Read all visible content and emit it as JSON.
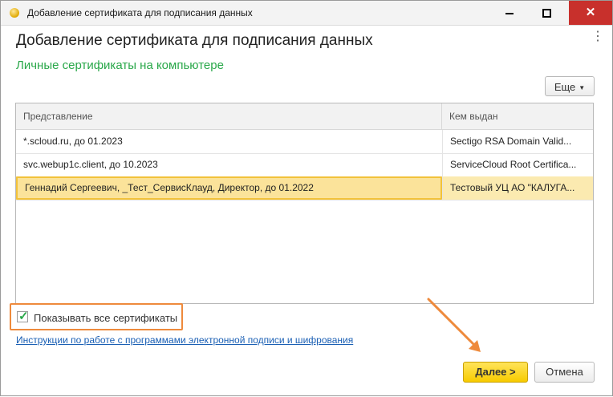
{
  "window": {
    "title": "Добавление сертификата для подписания данных",
    "app_icon": "1c-app-icon",
    "controls": [
      "minimize-icon",
      "maximize-icon",
      "close-icon"
    ]
  },
  "form": {
    "title": "Добавление сертификата для подписания данных",
    "menu_icon": "kebab-menu-icon",
    "section_label": "Личные сертификаты на компьютере",
    "more_button": {
      "label": "Еще",
      "icon": "caret-down-icon"
    }
  },
  "table": {
    "columns": [
      "Представление",
      "Кем выдан"
    ],
    "rows": [
      {
        "presentation": "*.scloud.ru, до 01.2023",
        "issuer": "Sectigo RSA Domain Valid...",
        "selected": false
      },
      {
        "presentation": "svc.webup1c.client, до 10.2023",
        "issuer": "ServiceCloud Root Certifica...",
        "selected": false
      },
      {
        "presentation": "Геннадий Сергеевич, _Тест_СервисКлауд, Директор, до 01.2022",
        "issuer": "Тестовый УЦ АО \"КАЛУГА...",
        "selected": true
      }
    ]
  },
  "show_all": {
    "label": "Показывать все сертификаты",
    "checked": true
  },
  "help_link": "Инструкции по работе с программами электронной подписи и шифрования",
  "buttons": {
    "next": "Далее >",
    "cancel": "Отмена"
  },
  "colors": {
    "accent_green": "#2aa84a",
    "highlight_orange": "#ee8a3c",
    "primary_button": "#f7cb00",
    "selected_row": "#fbeab0",
    "close_button": "#c8302c"
  }
}
